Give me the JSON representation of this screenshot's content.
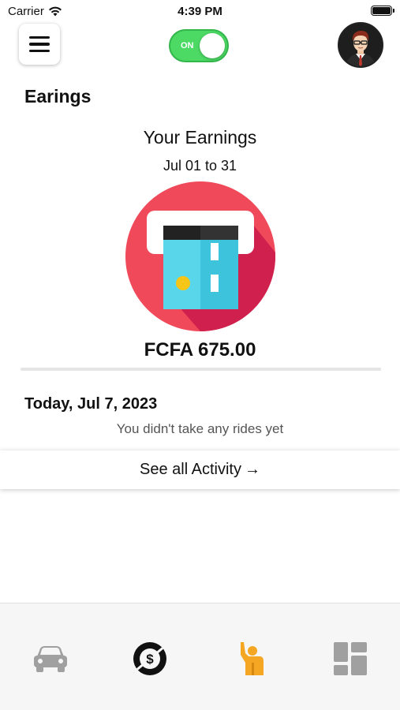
{
  "status_bar": {
    "carrier": "Carrier",
    "time": "4:39 PM"
  },
  "header": {
    "toggle_label": "ON",
    "toggle_on": true,
    "toggle_color": "#4cd964"
  },
  "page": {
    "title": "Earings",
    "earnings_heading": "Your Earnings",
    "date_range": "Jul 01 to 31",
    "amount": "FCFA 675.00",
    "today_label": "Today, Jul 7, 2023",
    "empty_message": "You didn't take any rides yet",
    "see_all_label": "See all Activity",
    "see_all_arrow": "→"
  },
  "tabbar": {
    "tabs": [
      {
        "icon": "car-icon",
        "active": false
      },
      {
        "icon": "dollar-coin-icon",
        "active": false
      },
      {
        "icon": "rider-waving-icon",
        "active": true
      },
      {
        "icon": "dashboard-grid-icon",
        "active": false
      }
    ],
    "active_color": "#f5a623",
    "inactive_color": "#a0a0a0"
  },
  "colors": {
    "illustration_circle": "#f04a5a",
    "card": "#5ad6ea"
  }
}
